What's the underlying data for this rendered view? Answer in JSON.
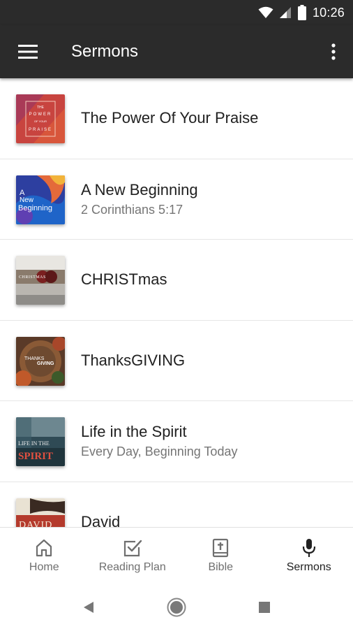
{
  "status_bar": {
    "time": "10:26",
    "icons": [
      "wifi-icon",
      "signal-icon",
      "battery-icon"
    ]
  },
  "app_bar": {
    "title": "Sermons",
    "menu_icon": "menu-icon",
    "more_icon": "more-vert-icon"
  },
  "sermons": [
    {
      "title": "The Power Of Your Praise",
      "subtitle": "",
      "art_text": [
        "THE",
        "POWER",
        "OF YOUR",
        "PRAISE"
      ]
    },
    {
      "title": "A New Beginning",
      "subtitle": "2 Corinthians 5:17",
      "art_text": [
        "A",
        "New",
        "Beginning"
      ]
    },
    {
      "title": "CHRISTmas",
      "subtitle": "",
      "art_text": [
        "CHRISTMAS"
      ]
    },
    {
      "title": "ThanksGIVING",
      "subtitle": "",
      "art_text": [
        "THANKS",
        "GIVING"
      ]
    },
    {
      "title": "Life in the Spirit",
      "subtitle": "Every Day, Beginning Today",
      "art_text": [
        "LIFE IN THE",
        "SPIRIT"
      ]
    },
    {
      "title": "David",
      "subtitle": "",
      "art_text": [
        "DAVID"
      ]
    }
  ],
  "bottom_nav": [
    {
      "label": "Home",
      "icon": "home-icon",
      "active": false
    },
    {
      "label": "Reading Plan",
      "icon": "checkbox-icon",
      "active": false
    },
    {
      "label": "Bible",
      "icon": "bible-icon",
      "active": false
    },
    {
      "label": "Sermons",
      "icon": "microphone-icon",
      "active": true
    }
  ],
  "system_nav": {
    "icons": [
      "back-icon",
      "home-circle-icon",
      "recents-icon"
    ]
  },
  "colors": {
    "app_bar": "#2b2b2b",
    "active_nav": "#212121",
    "inactive_nav": "#6f6f6f"
  }
}
